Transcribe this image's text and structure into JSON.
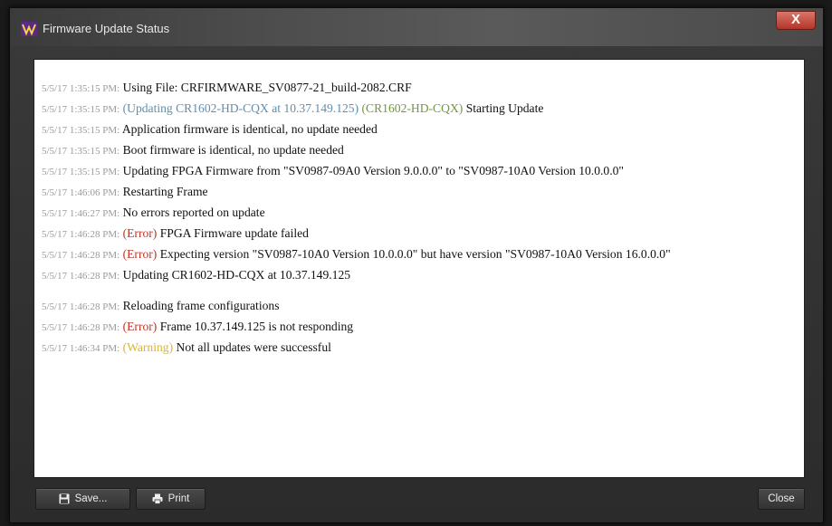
{
  "window": {
    "title": "Firmware Update Status",
    "close_glyph": "X"
  },
  "log": [
    {
      "ts": "5/5/17 1:35:15 PM:",
      "parts": [
        {
          "t": "Using File: CRFIRMWARE_SV0877-21_build-2082.CRF",
          "c": "text"
        }
      ]
    },
    {
      "ts": "5/5/17 1:35:15 PM:",
      "parts": [
        {
          "t": "(Updating CR1602-HD-CQX at 10.37.149.125)",
          "c": "info"
        },
        {
          "t": " (CR1602-HD-CQX)",
          "c": "device"
        },
        {
          "t": " Starting Update",
          "c": "text"
        }
      ]
    },
    {
      "ts": "5/5/17 1:35:15 PM:",
      "parts": [
        {
          "t": "Application firmware is identical, no update needed",
          "c": "text"
        }
      ]
    },
    {
      "ts": "5/5/17 1:35:15 PM:",
      "parts": [
        {
          "t": "Boot firmware is identical, no update needed",
          "c": "text"
        }
      ]
    },
    {
      "ts": "5/5/17 1:35:15 PM:",
      "parts": [
        {
          "t": "Updating FPGA Firmware from \"SV0987-09A0 Version 9.0.0.0\" to \"SV0987-10A0 Version 10.0.0.0\"",
          "c": "text"
        }
      ]
    },
    {
      "ts": "5/5/17 1:46:06 PM:",
      "parts": [
        {
          "t": "Restarting Frame",
          "c": "text"
        }
      ]
    },
    {
      "ts": "5/5/17 1:46:27 PM:",
      "parts": [
        {
          "t": "No errors reported on update",
          "c": "text"
        }
      ]
    },
    {
      "ts": "5/5/17 1:46:28 PM:",
      "parts": [
        {
          "t": "(Error)",
          "c": "error"
        },
        {
          "t": " FPGA Firmware update failed",
          "c": "text"
        }
      ]
    },
    {
      "ts": "5/5/17 1:46:28 PM:",
      "wrap": true,
      "parts": [
        {
          "t": "(Error)",
          "c": "error"
        },
        {
          "t": " Expecting version \"SV0987-10A0 Version 10.0.0.0\" but have version \"SV0987-10A0 Version 16.0.0.0\"",
          "c": "text"
        }
      ]
    },
    {
      "ts": "5/5/17 1:46:28 PM:",
      "parts": [
        {
          "t": "Updating CR1602-HD-CQX at 10.37.149.125",
          "c": "text"
        }
      ]
    },
    {
      "ts": "5/5/17 1:46:28 PM:",
      "gap": true,
      "parts": [
        {
          "t": "Reloading frame configurations",
          "c": "text"
        }
      ]
    },
    {
      "ts": "5/5/17 1:46:28 PM:",
      "parts": [
        {
          "t": "(Error)",
          "c": "error"
        },
        {
          "t": " Frame 10.37.149.125 is not responding",
          "c": "text"
        }
      ]
    },
    {
      "ts": "5/5/17 1:46:34 PM:",
      "parts": [
        {
          "t": "(Warning)",
          "c": "warning"
        },
        {
          "t": " Not all updates were successful",
          "c": "text"
        }
      ]
    }
  ],
  "buttons": {
    "save": "Save...",
    "print": "Print",
    "close": "Close"
  },
  "icons": {
    "app": "app-logo-icon",
    "save": "floppy-disk-icon",
    "print": "printer-icon"
  },
  "colors": {
    "timestamp": "#9a9a9a",
    "info": "#5d8fb2",
    "device": "#6f9a3a",
    "error": "#c13326",
    "warning": "#e0b528"
  }
}
